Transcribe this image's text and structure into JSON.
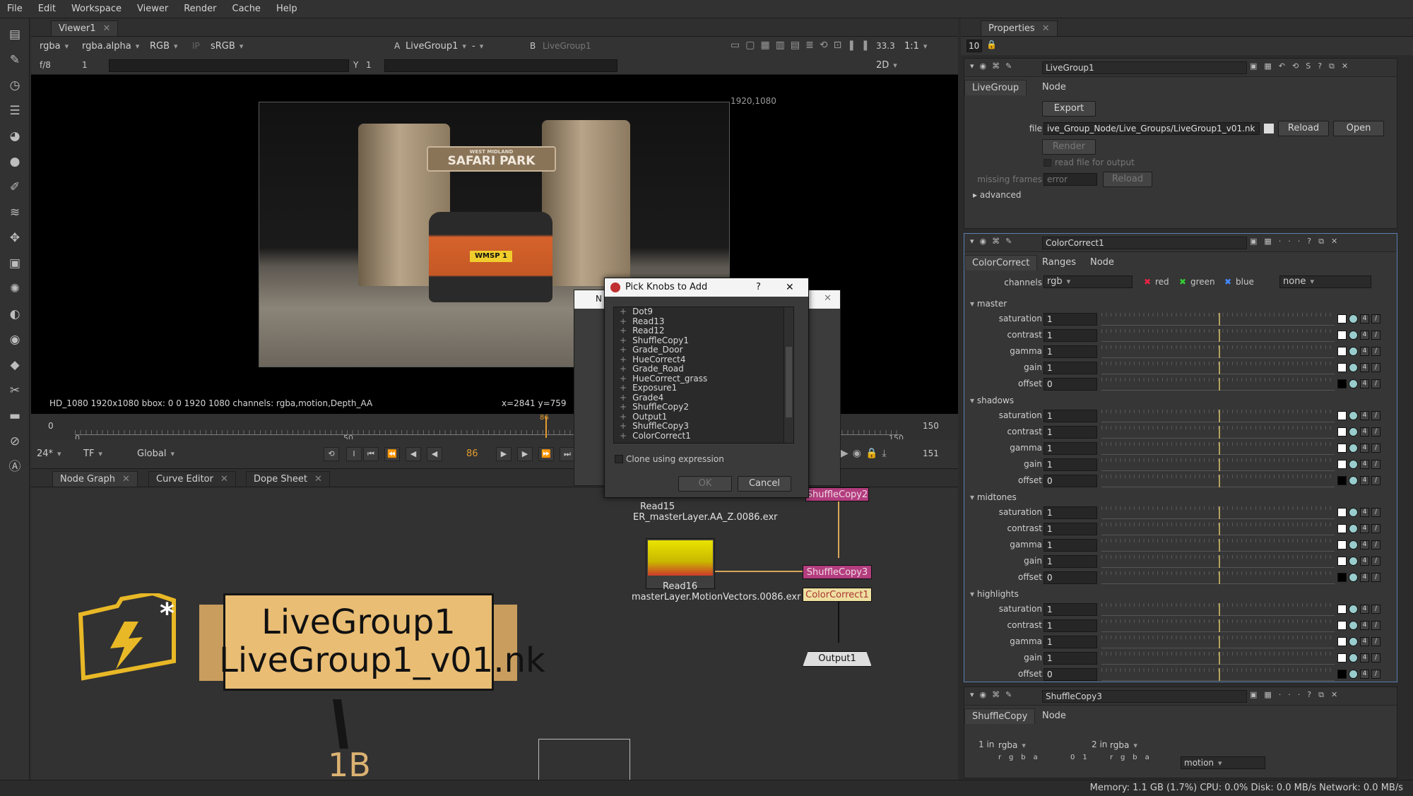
{
  "menu": [
    "File",
    "Edit",
    "Workspace",
    "Viewer",
    "Render",
    "Cache",
    "Help"
  ],
  "viewer": {
    "tab": "Viewer1",
    "channels": "rgba",
    "alpha": "rgba.alpha",
    "colorspace": "RGB",
    "ip": "IP",
    "lut": "sRGB",
    "input_a_label": "A",
    "input_a": "LiveGroup1",
    "input_mid": "-",
    "input_b_label": "B",
    "input_b": "LiveGroup1",
    "zoom": "33.3",
    "ratio": "1:1",
    "fstop": "f/8",
    "gain_val": "1",
    "y_label": "Y",
    "gamma_val": "1",
    "view_mode": "2D",
    "format_label": "1920,1080",
    "info": "HD_1080 1920x1080  bbox: 0 0 1920 1080 channels: rgba,motion,Depth_AA",
    "coords": "x=2841 y=759",
    "sign_small": "WEST MIDLAND",
    "sign_big": "SAFARI PARK",
    "plate": "WMSP 1"
  },
  "timeline": {
    "start": "0",
    "tick_0": "0",
    "tick_50": "50",
    "tick_150": "150",
    "current": "86",
    "end_field": "150",
    "fps": "24*",
    "tf": "TF",
    "scope": "Global",
    "end_frame": "151"
  },
  "bottom_tabs": [
    "Node Graph",
    "Curve Editor",
    "Dope Sheet"
  ],
  "nodes": {
    "read15": "Read15",
    "read15_file": "ER_masterLayer.AA_Z.0086.exr",
    "read16": "Read16",
    "read16_file": "masterLayer.MotionVectors.0086.exr",
    "shuffle2": "ShuffleCopy2",
    "shuffle3": "ShuffleCopy3",
    "colorcorrect": "ColorCorrect1",
    "output": "Output1",
    "livegroup_title": "LiveGroup1",
    "livegroup_file": "LiveGroup1_v01.nk",
    "badge": "1B"
  },
  "dialog": {
    "title": "Pick Knobs to Add",
    "help": "?",
    "close": "✕",
    "back_title": "N",
    "items": [
      "Dot9",
      "Read13",
      "Read12",
      "ShuffleCopy1",
      "Grade_Door",
      "HueCorrect4",
      "Grade_Road",
      "HueCorrect_grass",
      "Exposure1",
      "Grade4",
      "ShuffleCopy2",
      "Output1",
      "ShuffleCopy3",
      "ColorCorrect1"
    ],
    "clone_label": "Clone using expression",
    "ok": "OK",
    "cancel": "Cancel"
  },
  "properties": {
    "tab": "Properties",
    "max_panels": "10",
    "livegroup": {
      "name": "LiveGroup1",
      "tabs": [
        "LiveGroup",
        "Node"
      ],
      "export": "Export",
      "file_label": "file",
      "file_value": "ive_Group_Node/Live_Groups/LiveGroup1_v01.nk",
      "reload": "Reload",
      "open": "Open",
      "render": "Render",
      "read_output": "read file for output",
      "missing_label": "missing frames",
      "missing_value": "error",
      "reload2": "Reload",
      "advanced": "advanced"
    },
    "colorcorrect": {
      "name": "ColorCorrect1",
      "tabs": [
        "ColorCorrect",
        "Ranges",
        "Node"
      ],
      "channels_label": "channels",
      "channels_value": "rgb",
      "red": "red",
      "green": "green",
      "blue": "blue",
      "mask": "none",
      "sections": [
        {
          "title": "master",
          "rows": [
            {
              "label": "saturation",
              "value": "1"
            },
            {
              "label": "contrast",
              "value": "1"
            },
            {
              "label": "gamma",
              "value": "1"
            },
            {
              "label": "gain",
              "value": "1"
            },
            {
              "label": "offset",
              "value": "0"
            }
          ]
        },
        {
          "title": "shadows",
          "rows": [
            {
              "label": "saturation",
              "value": "1"
            },
            {
              "label": "contrast",
              "value": "1"
            },
            {
              "label": "gamma",
              "value": "1"
            },
            {
              "label": "gain",
              "value": "1"
            },
            {
              "label": "offset",
              "value": "0"
            }
          ]
        },
        {
          "title": "midtones",
          "rows": [
            {
              "label": "saturation",
              "value": "1"
            },
            {
              "label": "contrast",
              "value": "1"
            },
            {
              "label": "gamma",
              "value": "1"
            },
            {
              "label": "gain",
              "value": "1"
            },
            {
              "label": "offset",
              "value": "0"
            }
          ]
        },
        {
          "title": "highlights",
          "rows": [
            {
              "label": "saturation",
              "value": "1"
            },
            {
              "label": "contrast",
              "value": "1"
            },
            {
              "label": "gamma",
              "value": "1"
            },
            {
              "label": "gain",
              "value": "1"
            },
            {
              "label": "offset",
              "value": "0"
            }
          ]
        }
      ]
    },
    "shufflecopy": {
      "name": "ShuffleCopy3",
      "tabs": [
        "ShuffleCopy",
        "Node"
      ],
      "in1_label": "1 in",
      "in1": "rgba",
      "in2_label": "2 in",
      "in2": "rgba",
      "out": "motion",
      "chan_letters": [
        "r",
        "g",
        "b",
        "a"
      ],
      "chan_nums": [
        "0",
        "1"
      ]
    }
  },
  "status": "Memory: 1.1 GB (1.7%)  CPU: 0.0%  Disk: 0.0 MB/s  Network: 0.0 MB/s"
}
